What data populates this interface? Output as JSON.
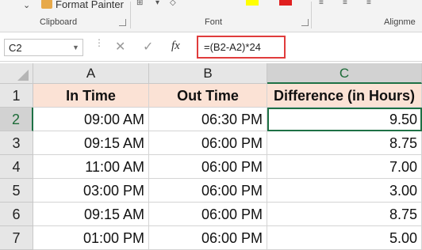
{
  "ribbon": {
    "format_painter": "Format Painter",
    "groups": [
      "Clipboard",
      "Font",
      "Alignme"
    ]
  },
  "formula_bar": {
    "name_box": "C2",
    "fx_label": "fx",
    "formula": "=(B2-A2)*24"
  },
  "sheet": {
    "columns": [
      "A",
      "B",
      "C"
    ],
    "rows": [
      "1",
      "2",
      "3",
      "4",
      "5",
      "6",
      "7"
    ],
    "headers": [
      "In Time",
      "Out Time",
      "Difference (in Hours)"
    ],
    "data": [
      [
        "09:00 AM",
        "06:30 PM",
        "9.50"
      ],
      [
        "09:15 AM",
        "06:00 PM",
        "8.75"
      ],
      [
        "11:00 AM",
        "06:00 PM",
        "7.00"
      ],
      [
        "03:00 PM",
        "06:00 PM",
        "3.00"
      ],
      [
        "09:15 AM",
        "06:00 PM",
        "8.75"
      ],
      [
        "01:00 PM",
        "06:00 PM",
        "5.00"
      ]
    ],
    "selected_cell": "C2"
  },
  "colors": {
    "header_fill": "#fbe2d5",
    "selection": "#1e7145",
    "formula_highlight": "#e03c3c"
  }
}
